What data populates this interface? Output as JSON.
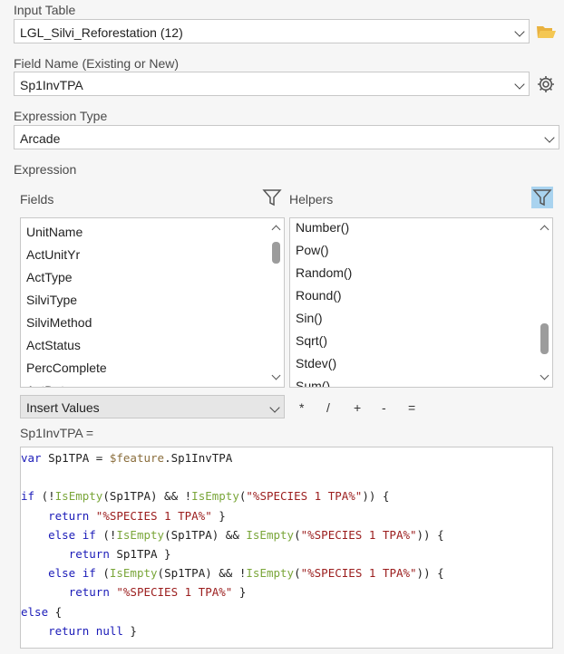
{
  "input_table": {
    "label": "Input Table",
    "value": "LGL_Silvi_Reforestation (12)"
  },
  "field_name": {
    "label": "Field Name (Existing or New)",
    "value": "Sp1InvTPA"
  },
  "expression_type": {
    "label": "Expression Type",
    "value": "Arcade"
  },
  "expression_label": "Expression",
  "fields": {
    "label": "Fields",
    "items": [
      "UnitName",
      "ActUnitYr",
      "ActType",
      "SilviType",
      "SilviMethod",
      "ActStatus",
      "PercComplete",
      "ActDate"
    ]
  },
  "helpers": {
    "label": "Helpers",
    "items": [
      "Number()",
      "Pow()",
      "Random()",
      "Round()",
      "Sin()",
      "Sqrt()",
      "Stdev()",
      "Sum()"
    ]
  },
  "insert_values": "Insert Values",
  "operators": [
    "*",
    "/",
    "+",
    "-",
    "="
  ],
  "target_label": "Sp1InvTPA =",
  "code_lines": [
    [
      {
        "t": "var",
        "c": "kw"
      },
      {
        "t": " Sp1TPA = ",
        "c": "tx"
      },
      {
        "t": "$feature",
        "c": "gl"
      },
      {
        "t": ".Sp1InvTPA",
        "c": "tx"
      }
    ],
    [],
    [
      {
        "t": "if",
        "c": "kw"
      },
      {
        "t": " (!",
        "c": "tx"
      },
      {
        "t": "IsEmpty",
        "c": "fn"
      },
      {
        "t": "(Sp1TPA) && !",
        "c": "tx"
      },
      {
        "t": "IsEmpty",
        "c": "fn"
      },
      {
        "t": "(",
        "c": "tx"
      },
      {
        "t": "\"%SPECIES 1 TPA%\"",
        "c": "str"
      },
      {
        "t": ")) {",
        "c": "tx"
      }
    ],
    [
      {
        "t": "    ",
        "c": "tx"
      },
      {
        "t": "return",
        "c": "kw"
      },
      {
        "t": " ",
        "c": "tx"
      },
      {
        "t": "\"%SPECIES 1 TPA%\"",
        "c": "str"
      },
      {
        "t": " }",
        "c": "tx"
      }
    ],
    [
      {
        "t": "    ",
        "c": "tx"
      },
      {
        "t": "else if",
        "c": "kw"
      },
      {
        "t": " (!",
        "c": "tx"
      },
      {
        "t": "IsEmpty",
        "c": "fn"
      },
      {
        "t": "(Sp1TPA) && ",
        "c": "tx"
      },
      {
        "t": "IsEmpty",
        "c": "fn"
      },
      {
        "t": "(",
        "c": "tx"
      },
      {
        "t": "\"%SPECIES 1 TPA%\"",
        "c": "str"
      },
      {
        "t": ")) {",
        "c": "tx"
      }
    ],
    [
      {
        "t": "       ",
        "c": "tx"
      },
      {
        "t": "return",
        "c": "kw"
      },
      {
        "t": " Sp1TPA }",
        "c": "tx"
      }
    ],
    [
      {
        "t": "    ",
        "c": "tx"
      },
      {
        "t": "else if",
        "c": "kw"
      },
      {
        "t": " (",
        "c": "tx"
      },
      {
        "t": "IsEmpty",
        "c": "fn"
      },
      {
        "t": "(Sp1TPA) && !",
        "c": "tx"
      },
      {
        "t": "IsEmpty",
        "c": "fn"
      },
      {
        "t": "(",
        "c": "tx"
      },
      {
        "t": "\"%SPECIES 1 TPA%\"",
        "c": "str"
      },
      {
        "t": ")) {",
        "c": "tx"
      }
    ],
    [
      {
        "t": "       ",
        "c": "tx"
      },
      {
        "t": "return",
        "c": "kw"
      },
      {
        "t": " ",
        "c": "tx"
      },
      {
        "t": "\"%SPECIES 1 TPA%\"",
        "c": "str"
      },
      {
        "t": " }",
        "c": "tx"
      }
    ],
    [
      {
        "t": "else",
        "c": "kw"
      },
      {
        "t": " {",
        "c": "tx"
      }
    ],
    [
      {
        "t": "    ",
        "c": "tx"
      },
      {
        "t": "return null",
        "c": "kw"
      },
      {
        "t": " }",
        "c": "tx"
      }
    ]
  ],
  "icons": {
    "open_table": "folder-open-icon",
    "field_settings": "gear-icon",
    "fields_filter": "funnel-icon",
    "helpers_filter": "funnel-icon"
  }
}
